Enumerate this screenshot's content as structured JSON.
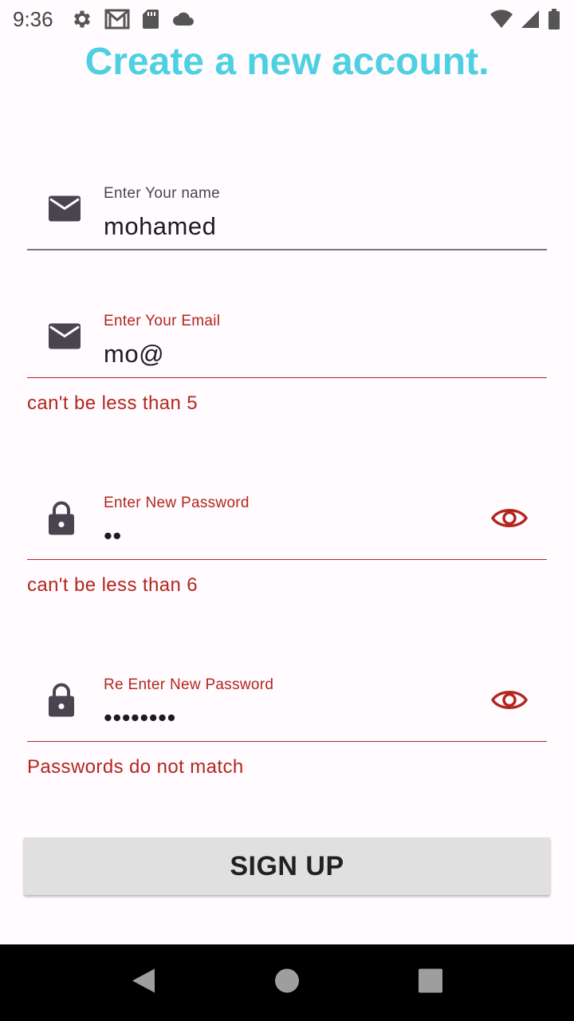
{
  "status_bar": {
    "time": "9:36",
    "left_icons": [
      "settings-icon",
      "gmail-icon",
      "sd-card-icon",
      "cloud-icon"
    ],
    "right_icons": [
      "wifi-icon",
      "signal-icon",
      "battery-icon"
    ]
  },
  "title": "Create a new account.",
  "colors": {
    "title": "#4dd0e1",
    "error": "#b3261e",
    "background": "#fffbfe",
    "button": "#e0e0e0"
  },
  "form": {
    "name": {
      "label": "Enter Your name",
      "value": "mohamed",
      "icon": "mail-icon"
    },
    "email": {
      "label": "Enter Your Email",
      "value": "mo@",
      "icon": "mail-icon",
      "error": "can't be less than 5"
    },
    "password": {
      "label": "Enter New Password",
      "value": "••",
      "icon": "lock-icon",
      "error": "can't be less than 6"
    },
    "confirm_password": {
      "label": "Re Enter New Password",
      "value": "••••••••",
      "icon": "lock-icon",
      "error": "Passwords do not match"
    }
  },
  "signup_button": {
    "label": "SIGN UP"
  }
}
